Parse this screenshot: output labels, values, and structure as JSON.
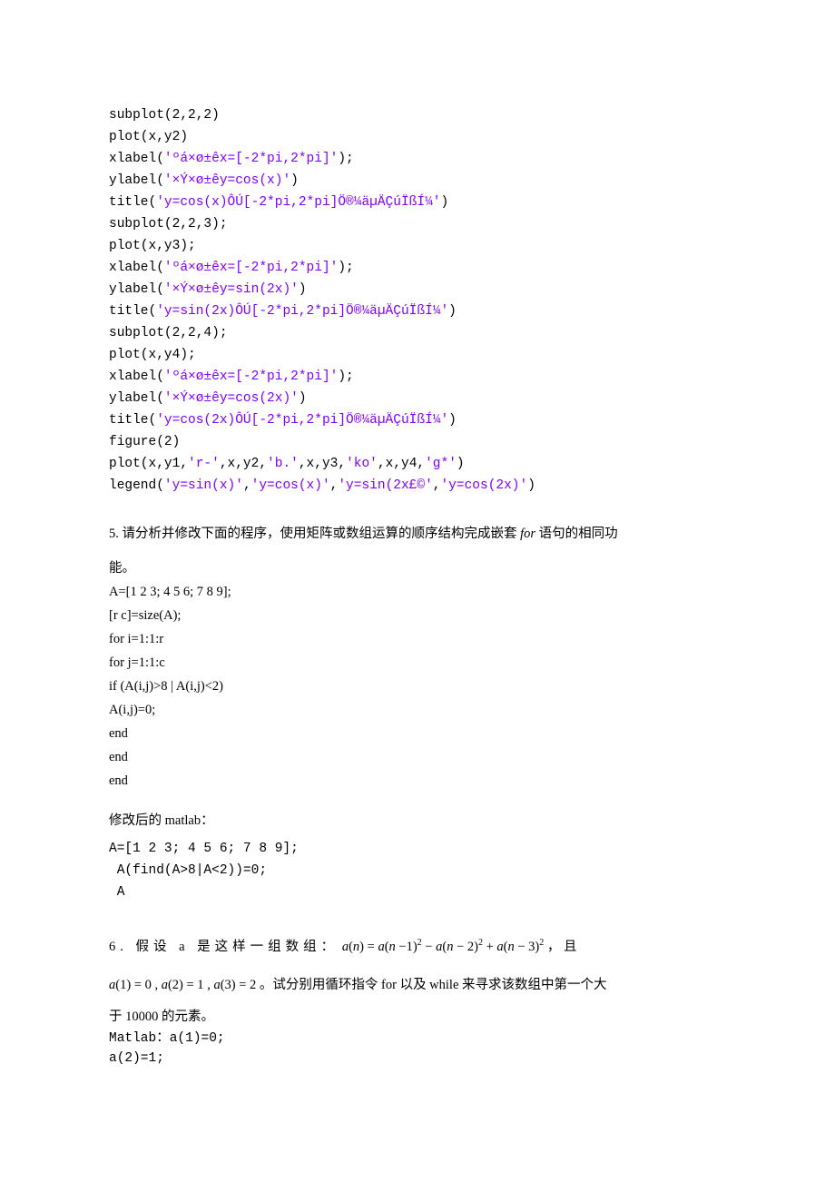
{
  "code1": {
    "l1": "subplot(2,2,2)",
    "l2": "plot(x,y2)",
    "l3a": "xlabel(",
    "l3b": "'ºá×ø±êx=[-2*pi,2*pi]'",
    "l3c": ");",
    "l4a": "ylabel(",
    "l4b": "'×Ý×ø±êy=cos(x)'",
    "l4c": ")",
    "l5a": "title(",
    "l5b": "'y=cos(x)ÔÚ[-2*pi,2*pi]Ö®¼äµÄÇúÏßÍ¼'",
    "l5c": ")",
    "l6": "subplot(2,2,3);",
    "l7": "plot(x,y3);",
    "l8a": "xlabel(",
    "l8b": "'ºá×ø±êx=[-2*pi,2*pi]'",
    "l8c": ");",
    "l9a": "ylabel(",
    "l9b": "'×Ý×ø±êy=sin(2x)'",
    "l9c": ")",
    "l10a": "title(",
    "l10b": "'y=sin(2x)ÔÚ[-2*pi,2*pi]Ö®¼äµÄÇúÏßÍ¼'",
    "l10c": ")",
    "l11": "subplot(2,2,4);",
    "l12": "plot(x,y4);",
    "l13a": "xlabel(",
    "l13b": "'ºá×ø±êx=[-2*pi,2*pi]'",
    "l13c": ");",
    "l14a": "ylabel(",
    "l14b": "'×Ý×ø±êy=cos(2x)'",
    "l14c": ")",
    "l15a": "title(",
    "l15b": "'y=cos(2x)ÔÚ[-2*pi,2*pi]Ö®¼äµÄÇúÏßÍ¼'",
    "l15c": ")",
    "l16": "figure(2)",
    "l17a": "plot(x,y1,",
    "l17b": "'r-'",
    "l17c": ",x,y2,",
    "l17d": "'b.'",
    "l17e": ",x,y3,",
    "l17f": "'ko'",
    "l17g": ",x,y4,",
    "l17h": "'g*'",
    "l17i": ")",
    "l18a": "legend(",
    "l18b": "'y=sin(x)'",
    "l18c": ",",
    "l18d": "'y=cos(x)'",
    "l18e": ",",
    "l18f": "'y=sin(2x£©'",
    "l18g": ",",
    "l18h": "'y=cos(2x)'",
    "l18i": ")"
  },
  "question5": {
    "prompt_a": "5.  请分析并修改下面的程序，使用矩阵或数组运算的顺序结构完成嵌套 ",
    "prompt_for": "for",
    "prompt_b": " 语句的相同功",
    "prompt_c": "能。",
    "p1": "  A=[1 2 3; 4 5 6; 7 8 9];",
    "p2": "  [r c]=size(A);",
    "p3": "  for i=1:1:r",
    "p4": "       for j=1:1:c",
    "p5": "            if (A(i,j)>8 | A(i,j)<2)",
    "p6": "                 A(i,j)=0;",
    "p7": "            end",
    "p8": "       end",
    "p9": "end",
    "mod_label": "修改后的 matlab：",
    "m1": "A=[1 2 3; 4 5 6; 7 8 9];",
    "m2": " A(find(A>8|A<2))=0;",
    "m3": " A"
  },
  "question6": {
    "line1_text": "6. 假设 a 是这样一组数组：",
    "eq1": " a(n) = a(n−1)² − a(n−2)² + a(n−3)² ",
    "line1_tail": "， 且",
    "eq2_a": "a(1) = 0",
    "eq2_b": "a(2) = 1",
    "eq2_c": "a(3) = 2",
    "line2_mid": "。试分别用循环指令 for  以及 while  来寻求该数组中第一个大",
    "line3": "于 10000  的元素。",
    "mlabel": "Matlab：",
    "m1": "a(1)=0;",
    "m2": "a(2)=1;"
  }
}
